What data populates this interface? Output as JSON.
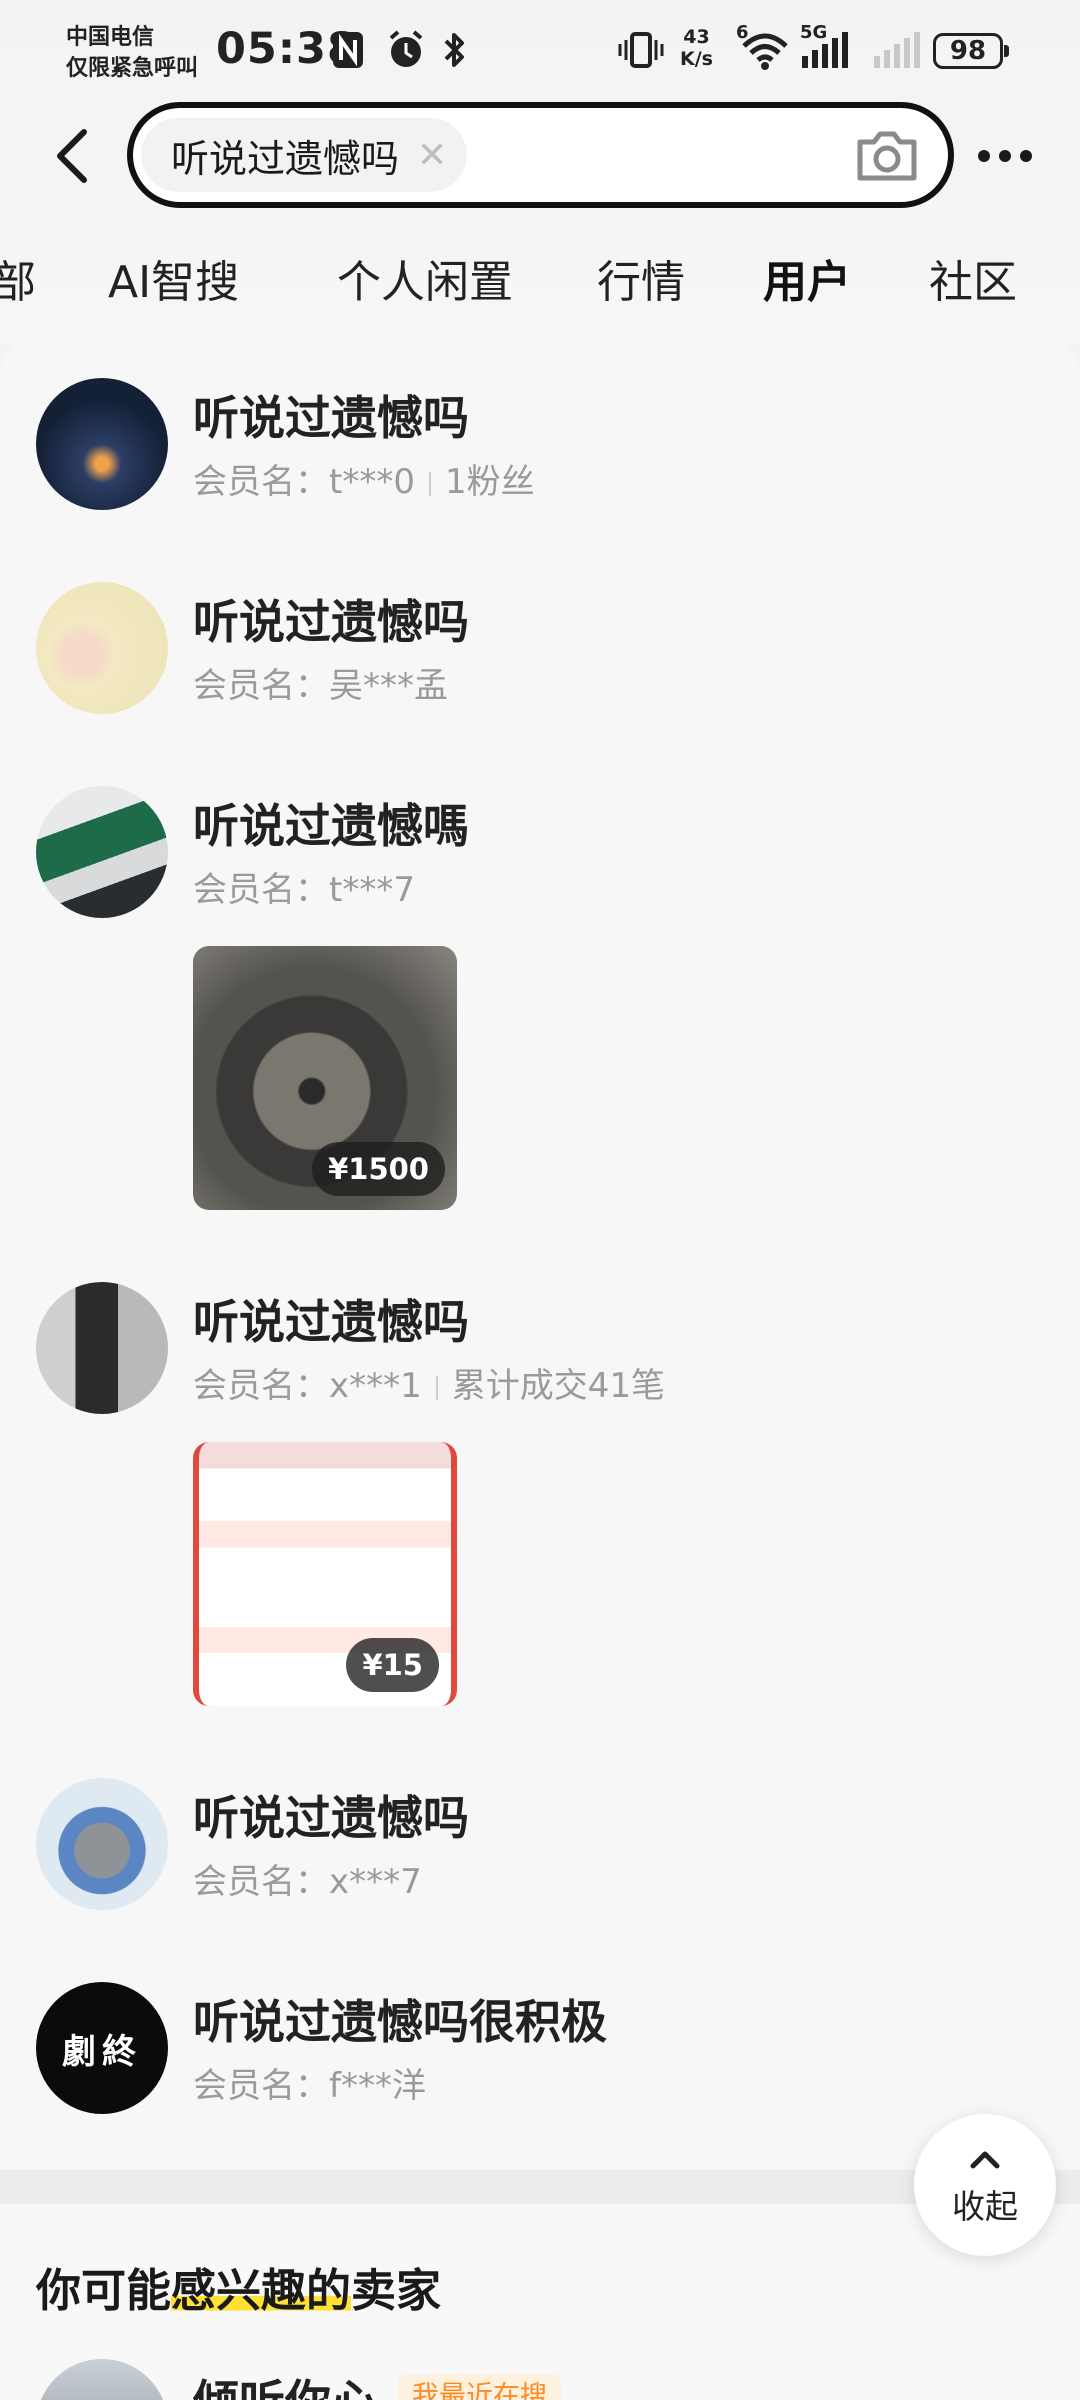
{
  "status_bar": {
    "carrier_line1": "中国电信",
    "carrier_line2": "仅限紧急呼叫",
    "time": "05:38",
    "net_speed_value": "43",
    "net_speed_unit": "K/s",
    "wifi_label": "6",
    "signal_label": "5G",
    "battery": "98",
    "icons": [
      "nfc-icon",
      "alarm-icon",
      "bluetooth-icon",
      "vibrate-icon",
      "wifi-icon",
      "signal-icon",
      "battery-icon"
    ]
  },
  "search": {
    "query": "听说过遗憾吗",
    "icons": [
      "back-icon",
      "clear-icon",
      "camera-icon",
      "more-icon"
    ]
  },
  "tabs": [
    {
      "label": "部"
    },
    {
      "label": "AI智搜"
    },
    {
      "label": "个人闲置"
    },
    {
      "label": "行情"
    },
    {
      "label": "用户",
      "active": true
    },
    {
      "label": "社区"
    }
  ],
  "users": [
    {
      "name": "听说过遗憾吗",
      "member_label": "会员名：",
      "member": "t***0",
      "extra": "1粉丝"
    },
    {
      "name": "听说过遗憾吗",
      "member_label": "会员名：",
      "member": "吴***孟"
    },
    {
      "name": "听说过遗憾嗎",
      "member_label": "会员名：",
      "member": "t***7",
      "item_price": "¥1500"
    },
    {
      "name": "听说过遗憾吗",
      "member_label": "会员名：",
      "member": "x***1",
      "extra": "累计成交41笔",
      "item_price": "¥15"
    },
    {
      "name": "听说过遗憾吗",
      "member_label": "会员名：",
      "member": "x***7"
    },
    {
      "name": "听说过遗憾吗很积极",
      "member_label": "会员名：",
      "member": "f***洋",
      "avatar_text": "劇終"
    }
  ],
  "collapse_button": {
    "label": "收起"
  },
  "recommend": {
    "title_prefix": "你可能",
    "title_highlight": "感兴趣的",
    "title_suffix": "卖家",
    "first_name": "倾听你心",
    "first_tag": "我最近在搜"
  },
  "colors": {
    "accent": "#ffe033",
    "tag_text": "#ff8a1f",
    "meta_text": "#9a9a9a"
  }
}
